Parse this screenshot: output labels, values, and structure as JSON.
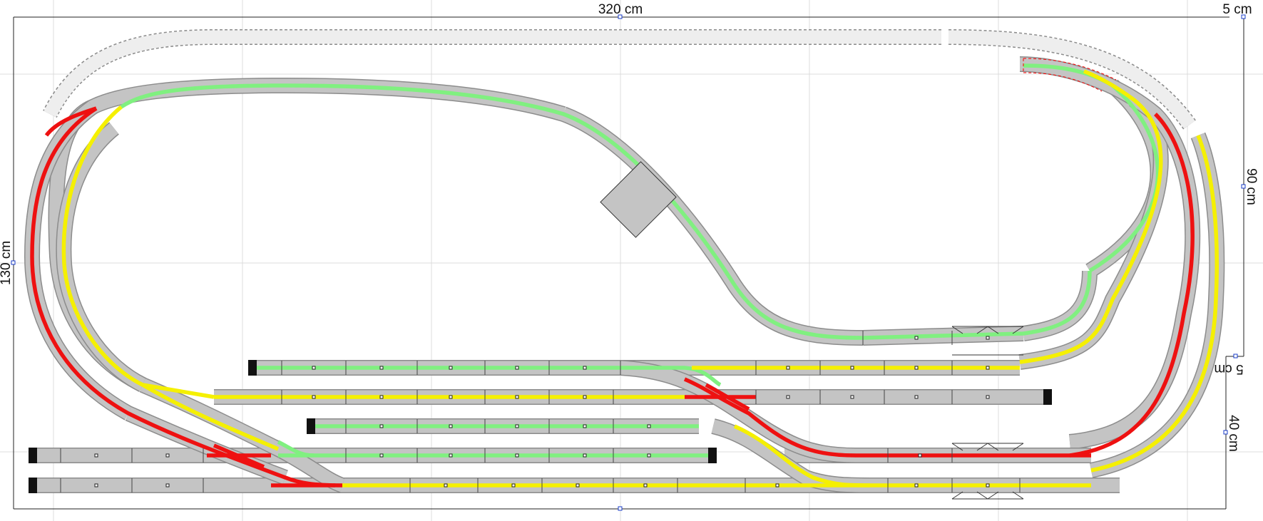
{
  "dimensions": {
    "top_width": "320 cm",
    "top_right": "5 cm",
    "left_height": "130 cm",
    "right_upper": "90 cm",
    "right_middle": "5 cm",
    "right_lower": "40 cm"
  },
  "colors": {
    "green_route": "#80f080",
    "yellow_route": "#f5f000",
    "red_route": "#ee1111",
    "track_gray": "#c4c4c4",
    "unused_track": "#eeeeee",
    "selection_red": "#ff0000",
    "grid": "#d8d8d8"
  },
  "icons": [
    "buffer-stop-icon",
    "crossing-gate-icon",
    "turntable-icon",
    "signal-marker-icon"
  ]
}
